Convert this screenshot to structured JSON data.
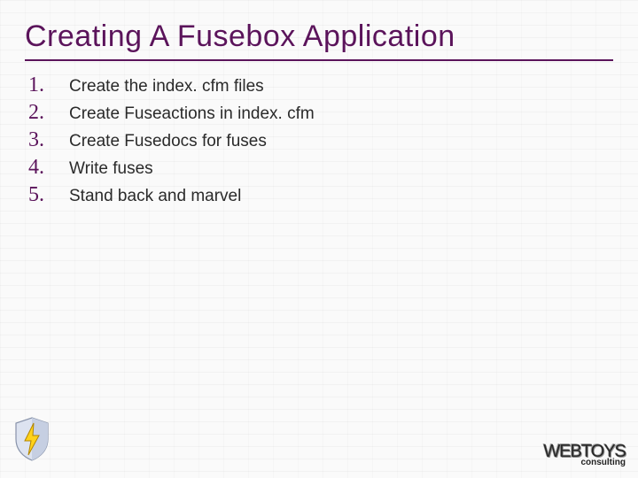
{
  "title": "Creating A Fusebox Application",
  "items": [
    {
      "n": "1.",
      "text": "Create the index. cfm files"
    },
    {
      "n": "2.",
      "text": "Create Fuseactions in index. cfm"
    },
    {
      "n": "3.",
      "text": "Create Fusedocs for fuses"
    },
    {
      "n": "4.",
      "text": "Write fuses"
    },
    {
      "n": "5.",
      "text": "Stand back and marvel"
    }
  ],
  "logo_left": "lightning-shield",
  "logo_right_top": "WEBTOYS",
  "logo_right_bottom": "consulting"
}
